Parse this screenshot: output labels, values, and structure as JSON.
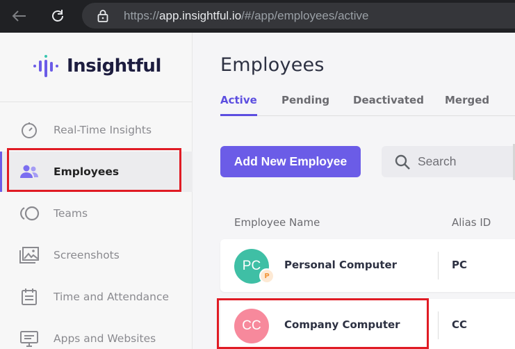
{
  "browser": {
    "url_prefix": "https://",
    "url_host": "app.insightful.io",
    "url_path": "/#/app/employees/active"
  },
  "sidebar": {
    "logo_text": "Insightful",
    "items": [
      {
        "label": "Real-Time Insights",
        "icon": "gauge-icon"
      },
      {
        "label": "Employees",
        "icon": "users-icon",
        "active": true
      },
      {
        "label": "Teams",
        "icon": "teams-icon"
      },
      {
        "label": "Screenshots",
        "icon": "images-icon"
      },
      {
        "label": "Time and Attendance",
        "icon": "calendar-icon"
      },
      {
        "label": "Apps and Websites",
        "icon": "monitor-icon"
      }
    ]
  },
  "main": {
    "title": "Employees",
    "tabs": [
      "Active",
      "Pending",
      "Deactivated",
      "Merged"
    ],
    "add_button": "Add New Employee",
    "search_placeholder": "Search",
    "columns": [
      "Employee Name",
      "Alias ID"
    ],
    "rows": [
      {
        "initials": "PC",
        "name": "Personal Computer",
        "alias": "PC",
        "badge": "P",
        "avatar_color": "#3fbfa5"
      },
      {
        "initials": "CC",
        "name": "Company Computer",
        "alias": "CC",
        "avatar_color": "#f7899c"
      }
    ]
  },
  "colors": {
    "accent": "#6b5ce7",
    "highlight": "#e01b24"
  }
}
